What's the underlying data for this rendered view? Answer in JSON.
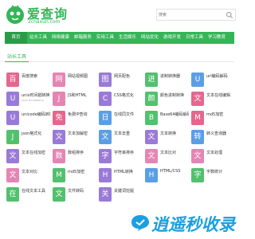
{
  "header": {
    "logo_title": "爱查询",
    "logo_subtitle": "2chaxun.com",
    "search_placeholder": "搜索"
  },
  "nav": {
    "items": [
      {
        "label": "首页",
        "active": true
      },
      {
        "label": "站长工具",
        "active": false
      },
      {
        "label": "网络健康",
        "active": false
      },
      {
        "label": "邮箱服务",
        "active": false
      },
      {
        "label": "实用工具",
        "active": false
      },
      {
        "label": "生活娱乐",
        "active": false
      },
      {
        "label": "网站优化",
        "active": false
      },
      {
        "label": "游戏开发",
        "active": false
      },
      {
        "label": "日常工具",
        "active": false
      },
      {
        "label": "学习教育",
        "active": false
      }
    ]
  },
  "section": {
    "title": "站长工具"
  },
  "tiles": [
    {
      "glyph": "百",
      "name": "百度搜索",
      "desc": "",
      "color": "#e4678f"
    },
    {
      "glyph": "网",
      "name": "网站视频图",
      "desc": "",
      "color": "#e486b4"
    },
    {
      "glyph": "图",
      "name": "网页配色",
      "desc": "",
      "color": "#9a7ad8"
    },
    {
      "glyph": "进",
      "name": "进制转换器",
      "desc": "",
      "color": "#53c06e"
    },
    {
      "glyph": "U",
      "name": "url编码解码",
      "desc": "",
      "color": "#5a9fe6"
    },
    {
      "glyph": "U",
      "name": "unix时间戳转换",
      "desc": "Unix timestamp",
      "color": "#9a7ad8"
    },
    {
      "glyph": "J",
      "name": "JS和HTML",
      "desc": "",
      "color": "#e486b4"
    },
    {
      "glyph": "C",
      "name": "CSS格式化",
      "desc": "",
      "color": "#9a7ad8"
    },
    {
      "glyph": "颜",
      "name": "颜色进制转换",
      "desc": "",
      "color": "#53c06e"
    },
    {
      "glyph": "文",
      "name": "文本在线编辑",
      "desc": "",
      "color": "#e4678f"
    },
    {
      "glyph": "U",
      "name": "unicode编码转换",
      "desc": "",
      "color": "#9a7ad8"
    },
    {
      "glyph": "免",
      "name": "免费IP查询",
      "desc": "",
      "color": "#e4678f"
    },
    {
      "glyph": "日",
      "name": "在线同文件",
      "desc": "",
      "color": "#5a9fe6"
    },
    {
      "glyph": "B",
      "name": "Base64编码解码",
      "desc": "",
      "color": "#53c06e"
    },
    {
      "glyph": "M",
      "name": "md5加密",
      "desc": "",
      "color": "#e4678f"
    },
    {
      "glyph": "J",
      "name": "json格式化",
      "desc": "",
      "color": "#53c06e"
    },
    {
      "glyph": "文",
      "name": "文本加解密",
      "desc": "",
      "color": "#9a7ad8"
    },
    {
      "glyph": "文",
      "name": "文本去重",
      "desc": "",
      "color": "#5a9fe6"
    },
    {
      "glyph": "文",
      "name": "文本转换",
      "desc": "",
      "color": "#9a7ad8"
    },
    {
      "glyph": "转",
      "name": "转义查询器",
      "desc": "",
      "color": "#5a9fe6"
    },
    {
      "glyph": "文",
      "name": "文本在线加密",
      "desc": "",
      "color": "#9a7ad8"
    },
    {
      "glyph": "数",
      "name": "数组排序",
      "desc": "",
      "color": "#e486b4"
    },
    {
      "glyph": "字",
      "name": "字符串排序",
      "desc": "",
      "color": "#9a7ad8"
    },
    {
      "glyph": "文",
      "name": "文本比对",
      "desc": "",
      "color": "#e486b4"
    },
    {
      "glyph": "文",
      "name": "文本处理",
      "desc": "",
      "color": "#e486b4"
    },
    {
      "glyph": "文",
      "name": "文本对比",
      "desc": "",
      "color": "#e486b4"
    },
    {
      "glyph": "M",
      "name": "md5加密",
      "desc": "",
      "color": "#53c06e"
    },
    {
      "glyph": "H",
      "name": "HTML转换",
      "desc": "",
      "color": "#9a7ad8"
    },
    {
      "glyph": "H",
      "name": "HTML/CSS",
      "desc": "",
      "color": "#5a9fe6"
    },
    {
      "glyph": "字",
      "name": "字数统计",
      "desc": "",
      "color": "#53c06e"
    },
    {
      "glyph": "在",
      "name": "在线文本工具",
      "desc": "",
      "color": "#53c06e"
    },
    {
      "glyph": "文",
      "name": "文件转码",
      "desc": "",
      "color": "#53c06e"
    },
    {
      "glyph": "关",
      "name": "关键词挖掘",
      "desc": "",
      "color": "#9a7ad8"
    }
  ],
  "watermark": {
    "text": "逍遥秒收录"
  }
}
